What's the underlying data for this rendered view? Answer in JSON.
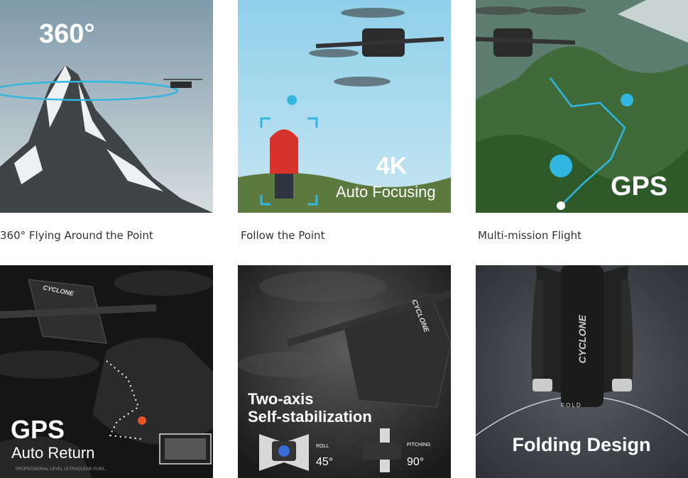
{
  "tiles": [
    {
      "headline": "360°",
      "caption": "360° Flying Around the Point"
    },
    {
      "headline": "4K",
      "subline": "Auto Focusing",
      "caption": "Follow the Point"
    },
    {
      "headline": "GPS",
      "caption": "Multi-mission Flight"
    },
    {
      "headline": "GPS",
      "subline": "Auto Return",
      "fineprint": "PROFESSIONAL LEVEL ULTRACLEAR PIXEL",
      "brand": "CYCLONE"
    },
    {
      "headline_line1": "Two-axis",
      "headline_line2": "Self-stabilization",
      "roll_label": "ROLL",
      "roll_value": "45°",
      "pitch_label": "PITCHING",
      "pitch_value": "90°",
      "brand": "CYCLONE"
    },
    {
      "headline": "Folding Design",
      "brand": "CYCLONE",
      "fold_label": "F O L D"
    }
  ],
  "colors": {
    "accent_cyan": "#31b6e0",
    "pin_orange": "#e8552a"
  }
}
